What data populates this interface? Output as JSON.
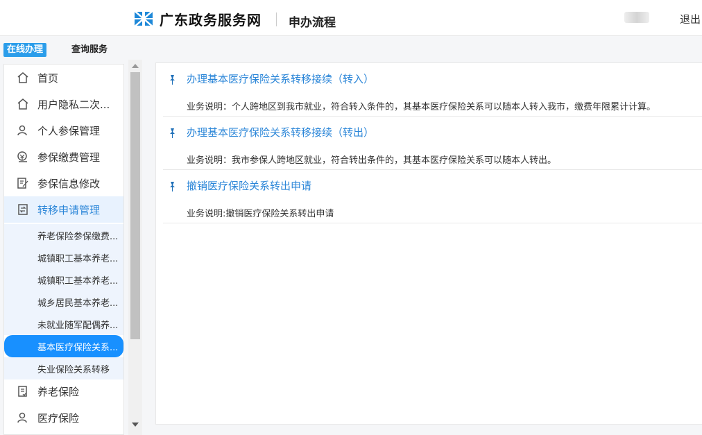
{
  "header": {
    "site_title": "广东政务服务网",
    "page_subtitle": "申办流程",
    "logout": "退出"
  },
  "mode_tabs": {
    "online": "在线办理",
    "query": "查询服务"
  },
  "sidebar": {
    "items": [
      {
        "label": "首页",
        "icon": "home-icon"
      },
      {
        "label": "用户隐私二次...",
        "icon": "home-icon"
      },
      {
        "label": "个人参保管理",
        "icon": "person-icon"
      },
      {
        "label": "参保缴费管理",
        "icon": "payment-icon"
      },
      {
        "label": "参保信息修改",
        "icon": "edit-icon"
      },
      {
        "label": "转移申请管理",
        "icon": "transfer-icon",
        "active": true
      }
    ],
    "sub_items": [
      {
        "label": "养老保险参保缴费..."
      },
      {
        "label": "城镇职工基本养老..."
      },
      {
        "label": "城镇职工基本养老..."
      },
      {
        "label": "城乡居民基本养老..."
      },
      {
        "label": "未就业随军配偶养..."
      },
      {
        "label": "基本医疗保险关系...",
        "selected": true
      },
      {
        "label": "失业保险关系转移"
      }
    ],
    "bottom_items": [
      {
        "label": "养老保险",
        "icon": "document-icon"
      },
      {
        "label": "医疗保险",
        "icon": "person-icon"
      }
    ]
  },
  "services": [
    {
      "title": "办理基本医疗保险关系转移接续（转入）",
      "desc": "业务说明：个人跨地区到我市就业，符合转入条件的，其基本医疗保险关系可以随本人转入我市，缴费年限累计计算。"
    },
    {
      "title": "办理基本医疗保险关系转移接续（转出）",
      "desc": "业务说明：我市参保人跨地区就业，符合转出条件的，其基本医疗保险关系可以随本人转出。"
    },
    {
      "title": "撤销医疗保险关系转出申请",
      "desc": "业务说明:撤销医疗保险关系转出申请"
    }
  ],
  "colors": {
    "accent": "#2b86d8",
    "selected_bg": "#1890ff",
    "tab_bg": "#2b9dea"
  }
}
